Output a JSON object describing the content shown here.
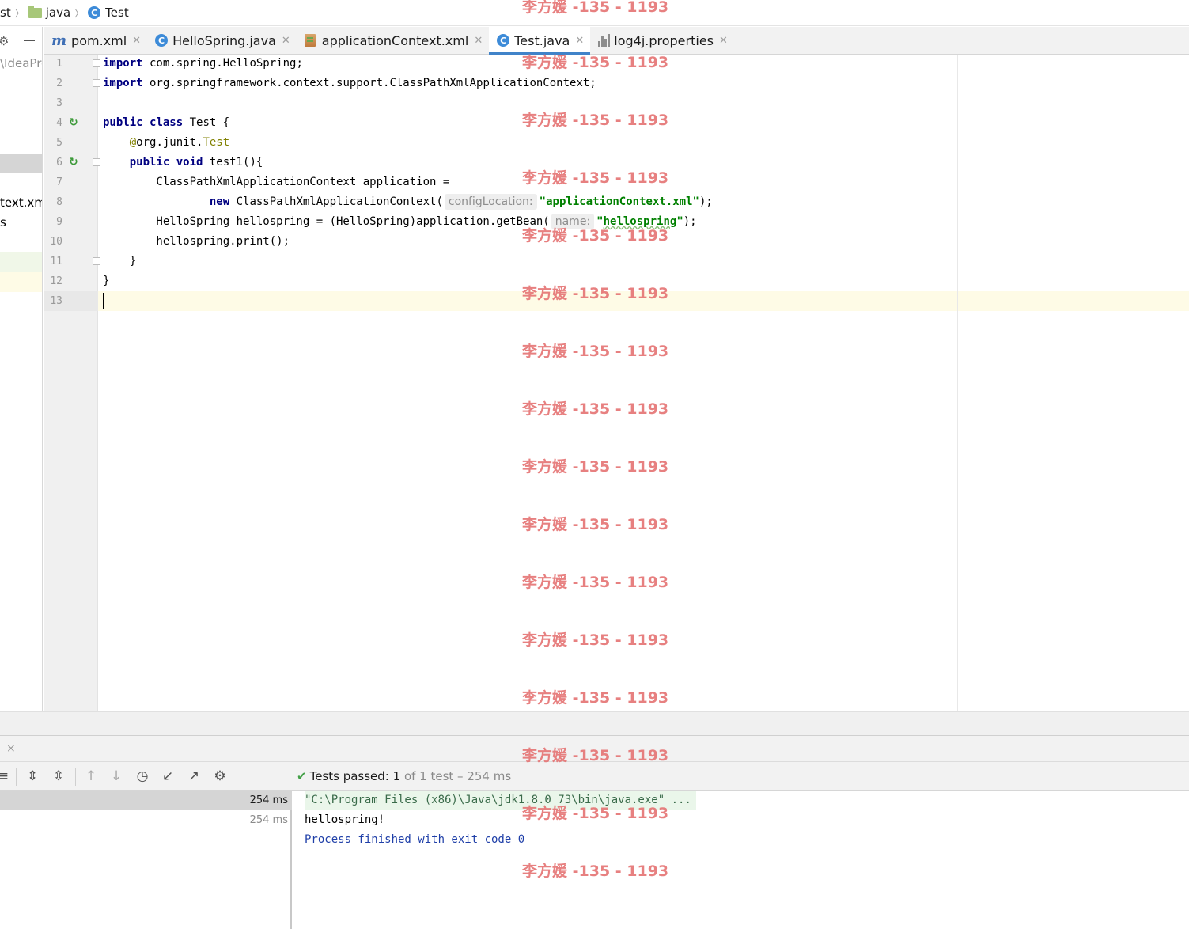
{
  "breadcrumb": {
    "items": [
      {
        "label": "st",
        "icon": ""
      },
      {
        "label": "java",
        "icon": "folder-icon"
      },
      {
        "label": "Test",
        "icon": "class-icon"
      }
    ]
  },
  "project_panel": {
    "rows": [
      {
        "text": "\\IdeaPro",
        "style": "gray"
      },
      {
        "text": "",
        "style": "selected"
      },
      {
        "text": "text.xm",
        "style": ""
      },
      {
        "text": "s",
        "style": ""
      },
      {
        "text": "",
        "style": "green"
      },
      {
        "text": "",
        "style": "yellow"
      }
    ]
  },
  "tabs": [
    {
      "label": "pom.xml",
      "icon": "maven-icon",
      "active": false
    },
    {
      "label": "HelloSpring.java",
      "icon": "class-icon",
      "active": false
    },
    {
      "label": "applicationContext.xml",
      "icon": "spring-xml-icon",
      "active": false
    },
    {
      "label": "Test.java",
      "icon": "test-class-icon",
      "active": true
    },
    {
      "label": "log4j.properties",
      "icon": "properties-icon",
      "active": false
    }
  ],
  "editor": {
    "line_numbers": [
      "1",
      "2",
      "3",
      "4",
      "5",
      "6",
      "7",
      "8",
      "9",
      "10",
      "11",
      "12",
      "13"
    ],
    "code": {
      "l1": {
        "kw": "import",
        "rest": " com.spring.HelloSpring;"
      },
      "l2": {
        "kw": "import",
        "rest": " org.springframework.context.support.ClassPathXmlApplicationContext;"
      },
      "l4": {
        "kw1": "public",
        "kw2": "class",
        "rest": " Test {"
      },
      "l5": {
        "indent": "    ",
        "ann_prefix": "@",
        "ann_pkg": "org.junit.",
        "ann_name": "Test"
      },
      "l6": {
        "indent": "    ",
        "kw1": "public",
        "kw2": "void",
        "rest": " test1(){"
      },
      "l7": {
        "text": "        ClassPathXmlApplicationContext application ="
      },
      "l8": {
        "indent": "                ",
        "kw": "new",
        "call": " ClassPathXmlApplicationContext(",
        "hint": "configLocation:",
        "str": "\"applicationContext.xml\"",
        "end": ");"
      },
      "l9": {
        "text": "        HelloSpring hellospring = (HelloSpring)application.getBean(",
        "hint": "name:",
        "str_q1": "\"",
        "str_body": "hellospring",
        "str_q2": "\"",
        "end": ");"
      },
      "l10": {
        "text": "        hellospring.print();"
      },
      "l11": {
        "text": "    }"
      },
      "l12": {
        "text": "}"
      }
    }
  },
  "run_panel": {
    "close_glyph": "×",
    "status": {
      "prefix": "Tests passed: ",
      "count": "1",
      "suffix": " of 1 test – 254 ms"
    },
    "tree": [
      {
        "time": "254 ms",
        "selected": true
      },
      {
        "time": "254 ms",
        "selected": false
      }
    ],
    "console": {
      "cmd": "\"C:\\Program Files (x86)\\Java\\jdk1.8.0_73\\bin\\java.exe\" ...",
      "output": "hellospring!",
      "exit": "Process finished with exit code 0"
    }
  },
  "watermark": {
    "text": "李方媛 -135 - 1193"
  },
  "colors": {
    "keyword": "#000080",
    "annotation": "#808000",
    "string": "#008000",
    "accent_tab": "#4083c9",
    "watermark": "#e57373",
    "pass": "#43a047"
  }
}
